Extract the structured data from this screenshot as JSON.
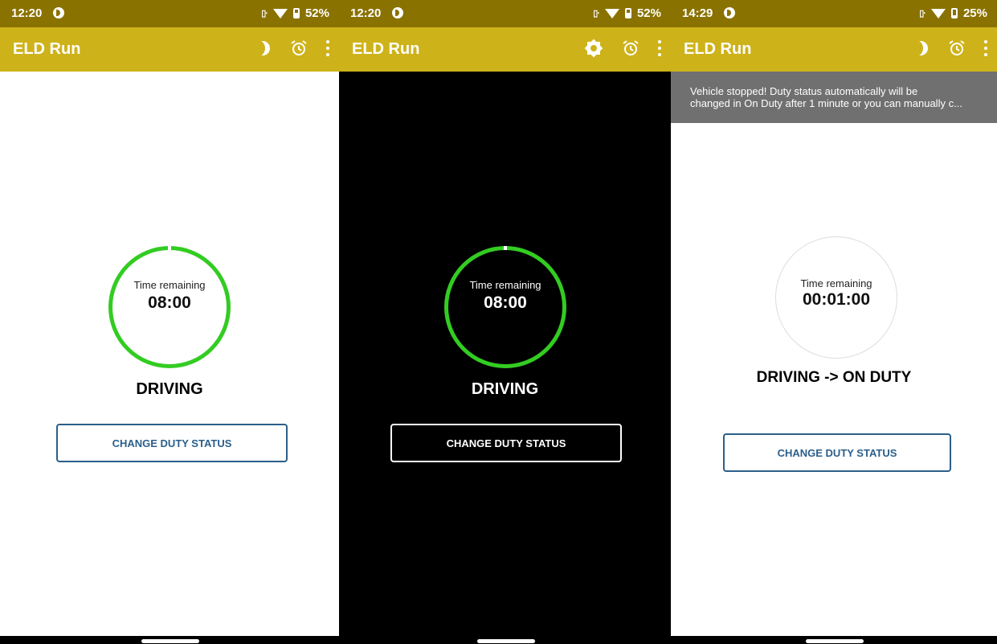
{
  "app_title": "ELD Run",
  "ring_label": "Time remaining",
  "button_label": "CHANGE DUTY STATUS",
  "colors": {
    "status_bar": "#8a7200",
    "app_bar": "#ceb21a",
    "ring_active": "#33cc22",
    "button_border": "#2b5f8a",
    "snackbar": "#707070"
  },
  "screens": [
    {
      "theme": "light",
      "time": "12:20",
      "battery": "52%",
      "battery_level": 0.52,
      "theme_toggle_icon": "moon-icon",
      "time_remaining": "08:00",
      "duty_status": "DRIVING"
    },
    {
      "theme": "dark",
      "time": "12:20",
      "battery": "52%",
      "battery_level": 0.52,
      "theme_toggle_icon": "sun-icon",
      "time_remaining": "08:00",
      "duty_status": "DRIVING"
    },
    {
      "theme": "light",
      "time": "14:29",
      "battery": "25%",
      "battery_level": 0.25,
      "theme_toggle_icon": "moon-icon",
      "time_remaining": "00:01:00",
      "duty_status": "DRIVING -> ON DUTY",
      "snackbar": {
        "line1": "Vehicle stopped! Duty status automatically will be",
        "line2": "changed in On Duty after 1 minute or you can manually c..."
      }
    }
  ]
}
